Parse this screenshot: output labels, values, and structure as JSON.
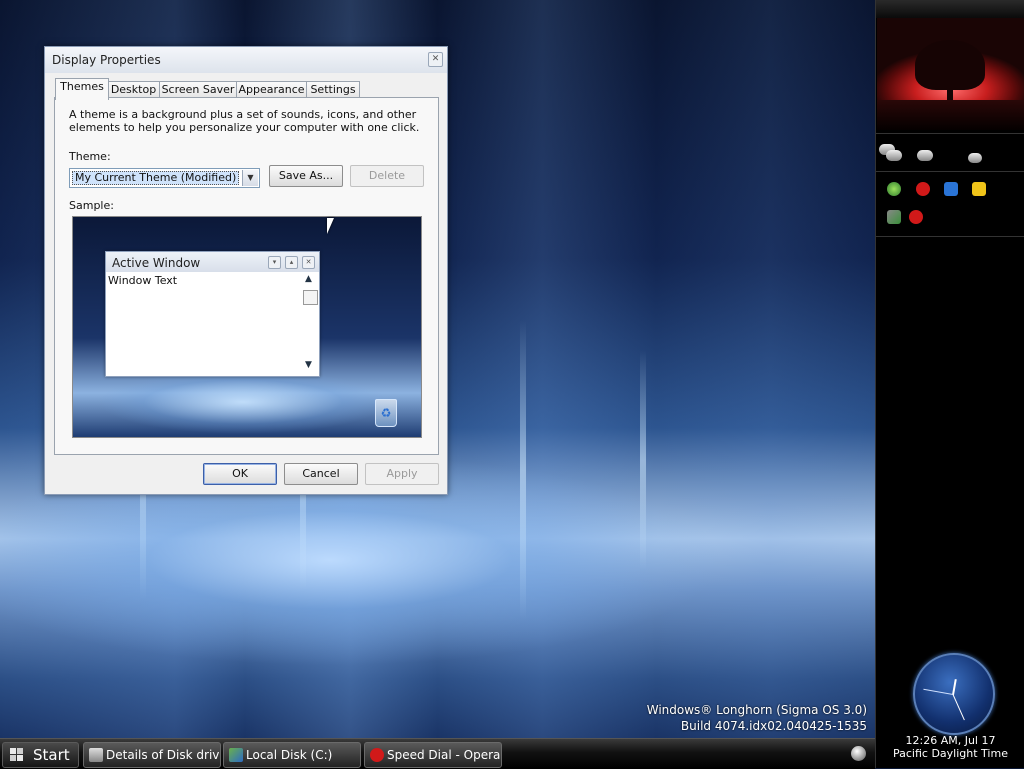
{
  "dialog": {
    "title": "Display Properties",
    "close_glyph": "✕",
    "tabs": [
      {
        "label": "Themes",
        "active": true
      },
      {
        "label": "Desktop"
      },
      {
        "label": "Screen Saver"
      },
      {
        "label": "Appearance"
      },
      {
        "label": "Settings"
      }
    ],
    "description": "A theme is a background plus a set of sounds, icons, and other elements to help you personalize your computer with one click.",
    "theme_label": "Theme:",
    "theme_value": "My Current Theme (Modified)",
    "save_as_label": "Save As...",
    "delete_label": "Delete",
    "sample_label": "Sample:",
    "sample": {
      "window_title": "Active Window",
      "window_text": "Window Text"
    },
    "ok_label": "OK",
    "cancel_label": "Cancel",
    "apply_label": "Apply"
  },
  "desktop": {
    "watermark_line1": "Windows® Longhorn (Sigma OS 3.0)",
    "watermark_line2": "Build 4074.idx02.040425-1535"
  },
  "taskbar": {
    "start_label": "Start",
    "items": [
      {
        "label": "Details of Disk drive",
        "icon": "back-arrow-icon"
      },
      {
        "label": "Local Disk (C:)",
        "icon": "drive-icon"
      },
      {
        "label": "Speed Dial - Opera",
        "icon": "opera-icon"
      }
    ]
  },
  "sidebar": {
    "clock_time": "12:26 AM, Jul 17",
    "clock_zone": "Pacific Daylight Time"
  },
  "colors": {
    "accent": "#3c5fa8",
    "opera_red": "#d11919"
  }
}
